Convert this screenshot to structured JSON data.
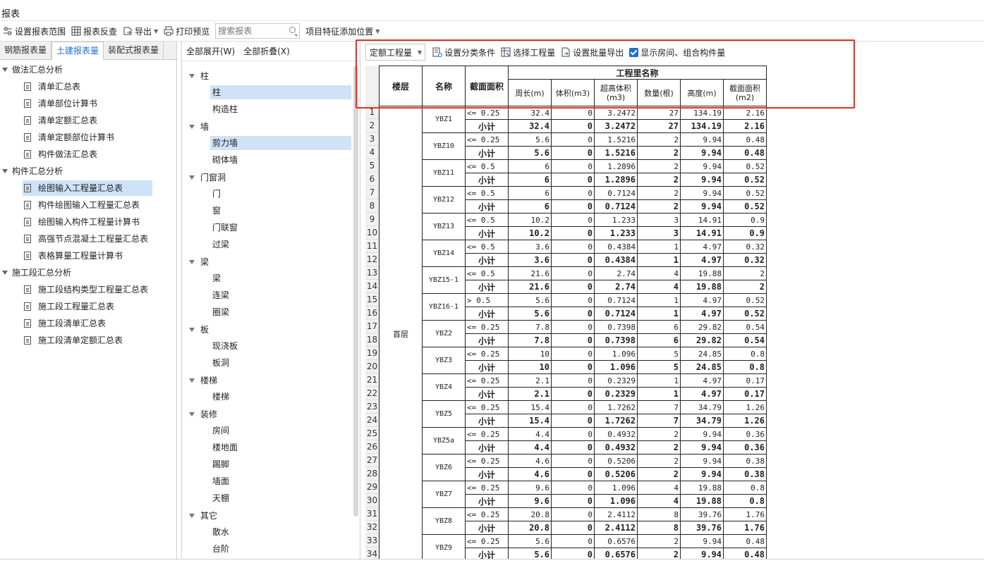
{
  "window": {
    "title": "报表"
  },
  "toolbar": {
    "set_range": "设置报表范围",
    "reverse_check": "报表反查",
    "export": "导出",
    "print_preview": "打印预览",
    "search_placeholder": "搜索报表",
    "add_feature_position": "项目特征添加位置"
  },
  "left_tabs": [
    "钢筋报表量",
    "土建报表量",
    "装配式报表量"
  ],
  "tree": {
    "groups": [
      {
        "label": "做法汇总分析",
        "items": [
          "清单汇总表",
          "清单部位计算书",
          "清单定额汇总表",
          "清单定额部位计算书",
          "构件做法汇总表"
        ]
      },
      {
        "label": "构件汇总分析",
        "items": [
          "绘图输入工程量汇总表",
          "构件绘图输入工程量汇总表",
          "绘图输入构件工程量计算书",
          "高强节点混凝土工程量汇总表",
          "表格算量工程量计算书"
        ]
      },
      {
        "label": "施工段汇总分析",
        "items": [
          "施工段结构类型工程量汇总表",
          "施工段工程量汇总表",
          "施工段清单汇总表",
          "施工段清单定额汇总表"
        ]
      }
    ],
    "selected": "绘图输入工程量汇总表"
  },
  "middle": {
    "expand_all": "全部展开(W)",
    "collapse_all": "全部折叠(X)",
    "categories": [
      {
        "label": "柱",
        "items": [
          "柱",
          "构造柱"
        ]
      },
      {
        "label": "墙",
        "items": [
          "剪力墙",
          "砌体墙"
        ]
      },
      {
        "label": "门窗洞",
        "items": [
          "门",
          "窗",
          "门联窗",
          "过梁"
        ]
      },
      {
        "label": "梁",
        "items": [
          "梁",
          "连梁",
          "圈梁"
        ]
      },
      {
        "label": "板",
        "items": [
          "现浇板",
          "板洞"
        ]
      },
      {
        "label": "楼梯",
        "items": [
          "楼梯"
        ]
      },
      {
        "label": "装修",
        "items": [
          "房间",
          "楼地面",
          "踢脚",
          "墙面",
          "天棚"
        ]
      },
      {
        "label": "其它",
        "items": [
          "散水",
          "台阶"
        ]
      }
    ],
    "selected": [
      "柱",
      "剪力墙"
    ]
  },
  "right_toolbar": {
    "quantity_type": "定额工程量",
    "set_classification": "设置分类条件",
    "select_quantity": "选择工程量",
    "batch_export": "设置批量导出",
    "show_rooms_label": "显示房间、组合构件量",
    "show_rooms_checked": true
  },
  "report": {
    "headers": {
      "floor": "楼层",
      "name": "名称",
      "section": "截面面积",
      "group": "工程里名称",
      "cols": [
        "周长(m)",
        "体积(m3)",
        "超高体积(m3)",
        "数量(根)",
        "高度(m)",
        "截面面积(m2)"
      ]
    },
    "floor_value": "首层",
    "subtotal_label": "小计",
    "groups": [
      {
        "name": "YBZ1",
        "cond": "<= 0.25",
        "v": [
          "32.4",
          "0",
          "3.2472",
          "27",
          "134.19",
          "2.16"
        ]
      },
      {
        "name": "YBZ10",
        "cond": "<= 0.25",
        "v": [
          "5.6",
          "0",
          "1.5216",
          "2",
          "9.94",
          "0.48"
        ]
      },
      {
        "name": "YBZ11",
        "cond": "<= 0.5",
        "v": [
          "6",
          "0",
          "1.2896",
          "2",
          "9.94",
          "0.52"
        ]
      },
      {
        "name": "YBZ12",
        "cond": "<= 0.5",
        "v": [
          "6",
          "0",
          "0.7124",
          "2",
          "9.94",
          "0.52"
        ]
      },
      {
        "name": "YBZ13",
        "cond": "<= 0.5",
        "v": [
          "10.2",
          "0",
          "1.233",
          "3",
          "14.91",
          "0.9"
        ]
      },
      {
        "name": "YBZ14",
        "cond": "<= 0.5",
        "v": [
          "3.6",
          "0",
          "0.4384",
          "1",
          "4.97",
          "0.32"
        ]
      },
      {
        "name": "YBZ15-1",
        "cond": "<= 0.5",
        "v": [
          "21.6",
          "0",
          "2.74",
          "4",
          "19.88",
          "2"
        ]
      },
      {
        "name": "YBZ16-1",
        "cond": "> 0.5",
        "v": [
          "5.6",
          "0",
          "0.7124",
          "1",
          "4.97",
          "0.52"
        ]
      },
      {
        "name": "YBZ2",
        "cond": "<= 0.25",
        "v": [
          "7.8",
          "0",
          "0.7398",
          "6",
          "29.82",
          "0.54"
        ]
      },
      {
        "name": "YBZ3",
        "cond": "<= 0.25",
        "v": [
          "10",
          "0",
          "1.096",
          "5",
          "24.85",
          "0.8"
        ]
      },
      {
        "name": "YBZ4",
        "cond": "<= 0.25",
        "v": [
          "2.1",
          "0",
          "0.2329",
          "1",
          "4.97",
          "0.17"
        ]
      },
      {
        "name": "YBZ5",
        "cond": "<= 0.25",
        "v": [
          "15.4",
          "0",
          "1.7262",
          "7",
          "34.79",
          "1.26"
        ]
      },
      {
        "name": "YBZ5a",
        "cond": "<= 0.25",
        "v": [
          "4.4",
          "0",
          "0.4932",
          "2",
          "9.94",
          "0.36"
        ]
      },
      {
        "name": "YBZ6",
        "cond": "<= 0.25",
        "v": [
          "4.6",
          "0",
          "0.5206",
          "2",
          "9.94",
          "0.38"
        ]
      },
      {
        "name": "YBZ7",
        "cond": "<= 0.25",
        "v": [
          "9.6",
          "0",
          "1.096",
          "4",
          "19.88",
          "0.8"
        ]
      },
      {
        "name": "YBZ8",
        "cond": "<= 0.25",
        "v": [
          "20.8",
          "0",
          "2.4112",
          "8",
          "39.76",
          "1.76"
        ]
      },
      {
        "name": "YBZ9",
        "cond": "<= 0.25",
        "v": [
          "5.6",
          "0",
          "0.6576",
          "2",
          "9.94",
          "0.48"
        ]
      }
    ]
  },
  "colors": {
    "accent": "#1f6fd0",
    "highlight_box": "#e0302b",
    "selection": "#cde3f8"
  }
}
